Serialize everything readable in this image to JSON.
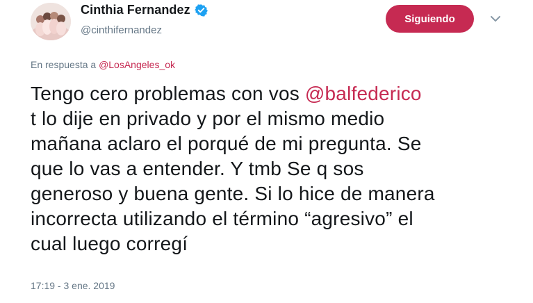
{
  "user": {
    "display_name": "Cinthia Fernandez",
    "handle": "@cinthifernandez"
  },
  "follow_button": {
    "label": "Siguiendo"
  },
  "reply": {
    "prefix": "En respuesta a ",
    "mention": "@LosAngeles_ok"
  },
  "tweet": {
    "line1_text": "Tengo cero problemas con vos ",
    "line1_mention": "@balfederico",
    "line2": "t lo dije en privado y por el mismo medio",
    "line3": "mañana aclaro el porqué de mi pregunta. Se",
    "line4": "que lo vas a entender. Y tmb Se q sos",
    "line5": "generoso y buena gente. Si lo hice de manera",
    "line6": "incorrecta utilizando el término “agresivo” el",
    "line7": "cual luego corregí"
  },
  "timestamp": "17:19 - 3 ene. 2019",
  "icons": {
    "verified": "verified-badge-icon",
    "menu": "chevron-down-icon"
  },
  "colors": {
    "accent": "#c62a52",
    "verified": "#1da1f2",
    "secondary_text": "#657786",
    "primary_text": "#14171a"
  }
}
